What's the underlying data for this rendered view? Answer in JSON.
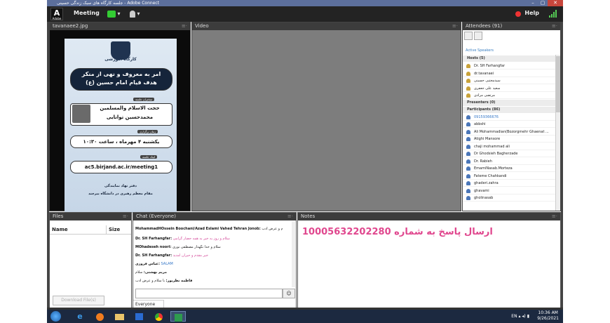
{
  "window": {
    "title": "جلسه کارگاه های سبک زندگی حسینی - Adobe Connect",
    "min": "–",
    "max": "▢",
    "close": "✕"
  },
  "appbar": {
    "logo_letter": "A",
    "logo_caption": "Adobe",
    "menu_meeting": "Meeting",
    "help": "Help",
    "audio_caret": "▾",
    "camera_caret": "▾"
  },
  "share_pod": {
    "title": "tavanaee2.jpg",
    "options": "≡·",
    "poster": {
      "workshop": "کارگاه آموزشی",
      "topic_line1": "امر به معروف و نهی از منکر",
      "topic_line2": "هدف قیام امام حسین (ع)",
      "speaker_tag": "سخنران جلسه",
      "speaker_line1": "حجت الاسلام والمسلمین",
      "speaker_line2": "محمدحسین توانایی",
      "time_tag": "زمان برگزاری",
      "time_text": "یکشنبه ۴ مهرماه ، ساعت ۱۰:۳۰",
      "link_tag": "لینک جلسه",
      "link_text": "ac5.birjand.ac.ir/meeting1",
      "footer_line1": "دفتر نهاد نمایندگی",
      "footer_line2": "مقام معظم رهبری در دانشگاه بیرجند"
    }
  },
  "video_pod": {
    "title": "Video",
    "options": "≡·"
  },
  "attendees_pod": {
    "title": "Attendees",
    "count": "(91)",
    "options": "≡·",
    "active_speakers": "Active Speakers",
    "hosts_label": "Hosts (5)",
    "hosts": [
      "Dr. SH Farhangfar",
      "dr.tavanaei",
      "سیدمجتبی حسینی",
      "سعید علی جعفری",
      "مرتضی مرادی"
    ],
    "presenters_label": "Presenters (0)",
    "participants_label": "Participants (86)",
    "participants": [
      "09159366676",
      "abbshi",
      "Ali Mohammadian(Bozorgmehr Ghaenat ...",
      "Atighi Mansore",
      "chaji mohammad ali",
      "Dr Ghodsieh Bagherzade",
      "Dr. Rabieh",
      "EmamiNasab.Morteza",
      "Fateme Chahkandi",
      "ghaderi.zahra",
      "ghavami",
      "gholinasab"
    ]
  },
  "files_pod": {
    "title": "Files",
    "options": "≡·",
    "col_name": "Name",
    "col_size": "Size",
    "download_button": "Download File(s)"
  },
  "chat_pod": {
    "title": "Chat",
    "scope": "(Everyone)",
    "options": "≡·",
    "messages": [
      {
        "author": "MohammadHOssein Boochani/Azad Eslami Vahed Tehran Jonob:",
        "text": "سلام و عرض ادب"
      },
      {
        "author": "Dr. SH Farhangfar:",
        "text": "سلام و روز به خیر به همه حضار گرامی"
      },
      {
        "author": "MOhadeseh noori:",
        "text": "سلام و خدا نگهدار مصطفی نوری"
      },
      {
        "author": "Dr. SH Farhangfar:",
        "text": "خیر مقدم و حیران آمدید"
      },
      {
        "author": "عباس فروزی:",
        "text": "SALAM"
      },
      {
        "author": "مریم بهشتی:",
        "text": "سلام"
      },
      {
        "author": "فاطمه نظریور:",
        "text": "با سلام و عرض ادب"
      }
    ],
    "send_icon": "☺",
    "tab_everyone": "Everyone"
  },
  "notes_pod": {
    "title": "Notes",
    "options": "≡·",
    "text": "ارسال پاسخ به شماره 10005632202280"
  },
  "taskbar": {
    "lang": "EN",
    "time": "10:36 AM",
    "date": "9/26/2021"
  }
}
